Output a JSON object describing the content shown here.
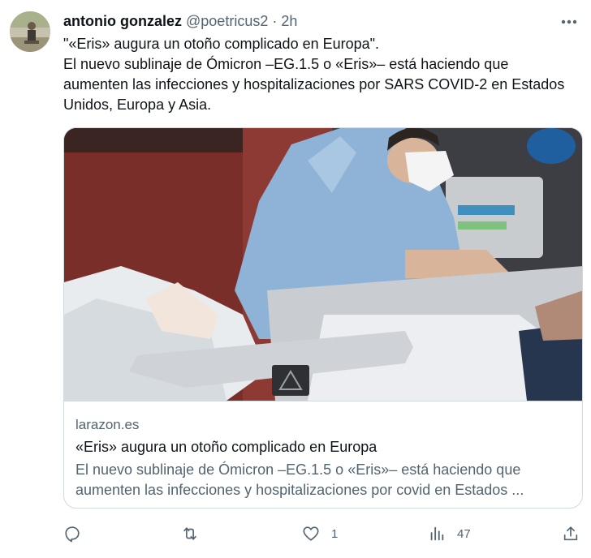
{
  "author": {
    "name": "antonio gonzalez",
    "handle": "@poetricus2",
    "separator": "·",
    "time": "2h"
  },
  "tweet": {
    "lines": [
      "\"«Eris» augura un otoño complicado en Europa\".",
      "El nuevo sublinaje de Ómicron –EG.1.5 o «Eris»– está haciendo que aumenten las infecciones y hospitalizaciones por SARS COVID-2 en Estados Unidos, Europa y Asia."
    ]
  },
  "link_card": {
    "domain": "larazon.es",
    "title": "«Eris» augura un otoño complicado en Europa",
    "description_line1": "El nuevo sublinaje de Ómicron –EG.1.5 o «Eris»– está haciendo que",
    "description_line2": "aumenten las infecciones y hospitalizaciones por covid en Estados ..."
  },
  "actions": {
    "reply_icon": "reply-icon",
    "retweet_icon": "retweet-icon",
    "like_icon": "heart-icon",
    "like_count": "1",
    "views_icon": "bar-chart-icon",
    "views_count": "47",
    "share_icon": "share-icon"
  },
  "colors": {
    "text": "#0f1419",
    "secondary": "#536471",
    "border": "#cfd9de"
  }
}
